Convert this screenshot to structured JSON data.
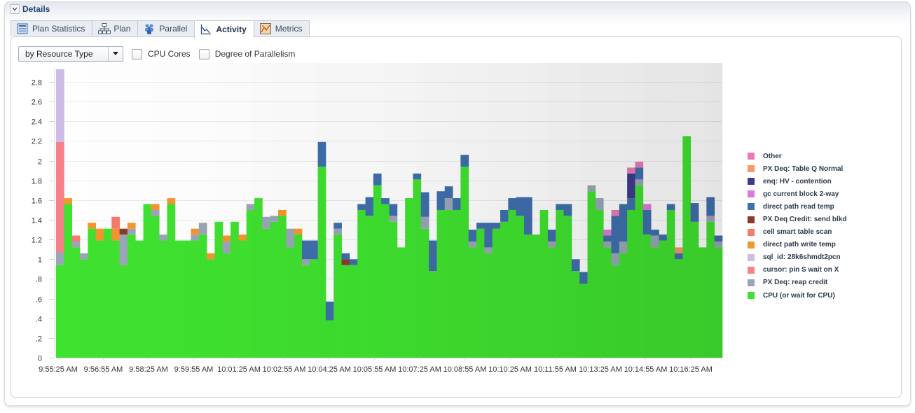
{
  "section": {
    "title": "Details",
    "collapse_icon": "chevron-down-icon"
  },
  "tabs": [
    {
      "label": "Plan Statistics",
      "icon": "table-icon",
      "active": false
    },
    {
      "label": "Plan",
      "icon": "hierarchy-icon",
      "active": false
    },
    {
      "label": "Parallel",
      "icon": "people-icon",
      "active": false
    },
    {
      "label": "Activity",
      "icon": "line-chart-icon",
      "active": true
    },
    {
      "label": "Metrics",
      "icon": "metrics-chart-icon",
      "active": false
    }
  ],
  "toolbar": {
    "group_by": {
      "value": "by Resource Type"
    },
    "checkboxes": [
      {
        "label": "CPU Cores",
        "checked": false
      },
      {
        "label": "Degree of Parallelism",
        "checked": false
      }
    ]
  },
  "chart_data": {
    "type": "bar",
    "stacked": true,
    "title": "",
    "xlabel": "",
    "ylabel": "",
    "ylim": [
      0,
      2.95
    ],
    "yticks": [
      0,
      0.2,
      0.4,
      0.6,
      0.8,
      1,
      1.2,
      1.4,
      1.6,
      1.8,
      2,
      2.2,
      2.4,
      2.6,
      2.8
    ],
    "ytick_labels": [
      "0",
      ".2",
      ".4",
      ".6",
      ".8",
      "1",
      "1.2",
      "1.4",
      "1.6",
      "1.8",
      "2",
      "2.2",
      "2.4",
      "2.6",
      "2.8"
    ],
    "grid": true,
    "legend_position": "right",
    "xtick_labels": [
      "9:55:25 AM",
      "9:56:55 AM",
      "9:58:25 AM",
      "9:59:55 AM",
      "10:01:25 AM",
      "10:02:55 AM",
      "10:04:25 AM",
      "10:05:55 AM",
      "10:07:25 AM",
      "10:08:55 AM",
      "10:10:25 AM",
      "10:11:55 AM",
      "10:13:25 AM",
      "10:14:55 AM",
      "10:16:25 AM"
    ],
    "xtick_every_n_bars": 5.6,
    "categories": [
      {
        "name": "CPU (or wait for CPU)",
        "color": "#3fe22f"
      },
      {
        "name": "PX Deq: reap credit",
        "color": "#9aa6b8"
      },
      {
        "name": "cursor: pin S wait on X",
        "color": "#f7808c"
      },
      {
        "name": "sql_id: 28k6shmdt2pcn",
        "color": "#cdbde6"
      },
      {
        "name": "direct path write temp",
        "color": "#f4962e"
      },
      {
        "name": "cell smart table scan",
        "color": "#f57b6a"
      },
      {
        "name": "PX Deq Credit: send blkd",
        "color": "#8b3a2a"
      },
      {
        "name": "direct path read temp",
        "color": "#3f6fad"
      },
      {
        "name": "gc current block 2-way",
        "color": "#e07ad8"
      },
      {
        "name": "enq: HV - contention",
        "color": "#3d3a8e"
      },
      {
        "name": "PX Deq: Table Q Normal",
        "color": "#f5996a"
      },
      {
        "name": "Other",
        "color": "#ec7ab8"
      }
    ],
    "legend_order": [
      11,
      10,
      9,
      8,
      7,
      6,
      5,
      4,
      3,
      2,
      1,
      0
    ],
    "bars": [
      [
        [
          0,
          0.94
        ],
        [
          1,
          0.13
        ],
        [
          2,
          1.12
        ],
        [
          3,
          0.74
        ]
      ],
      [
        [
          0,
          1.56
        ],
        [
          4,
          0.06
        ]
      ],
      [
        [
          0,
          1.12
        ],
        [
          1,
          0.06
        ],
        [
          5,
          0.06
        ]
      ],
      [
        [
          0,
          1.0
        ],
        [
          1,
          0.06
        ]
      ],
      [
        [
          0,
          1.31
        ],
        [
          4,
          0.06
        ]
      ],
      [
        [
          0,
          1.19
        ],
        [
          4,
          0.12
        ]
      ],
      [
        [
          0,
          1.31
        ]
      ],
      [
        [
          0,
          1.19
        ],
        [
          4,
          0.12
        ],
        [
          5,
          0.12
        ]
      ],
      [
        [
          0,
          0.94
        ],
        [
          1,
          0.31
        ],
        [
          6,
          0.06
        ]
      ],
      [
        [
          0,
          1.25
        ],
        [
          1,
          0.06
        ],
        [
          4,
          0.06
        ]
      ],
      [
        [
          0,
          1.19
        ]
      ],
      [
        [
          0,
          1.56
        ]
      ],
      [
        [
          0,
          1.44
        ],
        [
          1,
          0.06
        ],
        [
          4,
          0.06
        ]
      ],
      [
        [
          0,
          1.19
        ],
        [
          1,
          0.06
        ]
      ],
      [
        [
          0,
          1.56
        ],
        [
          4,
          0.06
        ]
      ],
      [
        [
          0,
          1.19
        ]
      ],
      [
        [
          0,
          1.19
        ]
      ],
      [
        [
          0,
          1.19
        ],
        [
          1,
          0.06
        ],
        [
          4,
          0.06
        ]
      ],
      [
        [
          0,
          1.25
        ],
        [
          1,
          0.12
        ]
      ],
      [
        [
          0,
          1.0
        ],
        [
          4,
          0.06
        ]
      ],
      [
        [
          0,
          1.38
        ]
      ],
      [
        [
          0,
          1.06
        ],
        [
          1,
          0.12
        ],
        [
          4,
          0.06
        ]
      ],
      [
        [
          0,
          1.38
        ]
      ],
      [
        [
          0,
          1.19
        ],
        [
          4,
          0.06
        ]
      ],
      [
        [
          0,
          1.5
        ],
        [
          1,
          0.06
        ]
      ],
      [
        [
          0,
          1.62
        ]
      ],
      [
        [
          0,
          1.31
        ],
        [
          1,
          0.12
        ]
      ],
      [
        [
          0,
          1.38
        ],
        [
          1,
          0.06
        ]
      ],
      [
        [
          0,
          1.44
        ],
        [
          4,
          0.06
        ]
      ],
      [
        [
          0,
          1.12
        ],
        [
          1,
          0.19
        ]
      ],
      [
        [
          0,
          1.25
        ],
        [
          4,
          0.06
        ]
      ],
      [
        [
          0,
          0.94
        ],
        [
          1,
          0.06
        ],
        [
          7,
          0.19
        ]
      ],
      [
        [
          0,
          1.0
        ],
        [
          7,
          0.19
        ]
      ],
      [
        [
          0,
          1.94
        ],
        [
          7,
          0.25
        ]
      ],
      [
        [
          0,
          0.38
        ],
        [
          7,
          0.19
        ]
      ],
      [
        [
          0,
          1.25
        ],
        [
          1,
          0.06
        ],
        [
          7,
          0.06
        ]
      ],
      [
        [
          0,
          0.94
        ],
        [
          6,
          0.06
        ],
        [
          7,
          0.06
        ]
      ],
      [
        [
          0,
          0.94
        ],
        [
          7,
          0.06
        ]
      ],
      [
        [
          0,
          1.5
        ],
        [
          7,
          0.06
        ]
      ],
      [
        [
          0,
          1.44
        ],
        [
          7,
          0.19
        ]
      ],
      [
        [
          0,
          1.75
        ],
        [
          7,
          0.12
        ]
      ],
      [
        [
          0,
          1.56
        ],
        [
          7,
          0.06
        ]
      ],
      [
        [
          0,
          1.38
        ],
        [
          1,
          0.06
        ],
        [
          7,
          0.12
        ]
      ],
      [
        [
          0,
          1.12
        ]
      ],
      [
        [
          0,
          1.62
        ]
      ],
      [
        [
          0,
          1.81
        ],
        [
          7,
          0.06
        ]
      ],
      [
        [
          0,
          1.31
        ],
        [
          1,
          0.12
        ],
        [
          7,
          0.25
        ]
      ],
      [
        [
          0,
          0.88
        ],
        [
          7,
          0.31
        ]
      ],
      [
        [
          0,
          1.5
        ],
        [
          7,
          0.19
        ]
      ],
      [
        [
          0,
          1.5
        ],
        [
          1,
          0.12
        ],
        [
          7,
          0.12
        ]
      ],
      [
        [
          0,
          1.5
        ],
        [
          7,
          0.12
        ]
      ],
      [
        [
          0,
          1.94
        ],
        [
          7,
          0.12
        ]
      ],
      [
        [
          0,
          1.12
        ],
        [
          1,
          0.06
        ],
        [
          7,
          0.12
        ]
      ],
      [
        [
          0,
          1.31
        ],
        [
          7,
          0.06
        ]
      ],
      [
        [
          0,
          1.06
        ],
        [
          1,
          0.06
        ],
        [
          7,
          0.25
        ]
      ],
      [
        [
          0,
          1.31
        ],
        [
          7,
          0.06
        ]
      ],
      [
        [
          0,
          1.38
        ],
        [
          7,
          0.12
        ]
      ],
      [
        [
          0,
          1.5
        ],
        [
          7,
          0.12
        ]
      ],
      [
        [
          0,
          1.44
        ],
        [
          7,
          0.19
        ]
      ],
      [
        [
          0,
          1.25
        ],
        [
          7,
          0.38
        ]
      ],
      [
        [
          0,
          1.25
        ]
      ],
      [
        [
          0,
          1.5
        ]
      ],
      [
        [
          0,
          1.12
        ],
        [
          1,
          0.06
        ],
        [
          7,
          0.12
        ]
      ],
      [
        [
          0,
          1.5
        ],
        [
          7,
          0.06
        ]
      ],
      [
        [
          0,
          1.44
        ],
        [
          7,
          0.12
        ]
      ],
      [
        [
          0,
          0.88
        ],
        [
          7,
          0.12
        ]
      ],
      [
        [
          0,
          0.75
        ],
        [
          7,
          0.12
        ]
      ],
      [
        [
          0,
          1.69
        ],
        [
          1,
          0.06
        ]
      ],
      [
        [
          0,
          1.5
        ],
        [
          1,
          0.12
        ]
      ],
      [
        [
          0,
          1.12
        ],
        [
          1,
          0.06
        ],
        [
          7,
          0.06
        ],
        [
          8,
          0.06
        ]
      ],
      [
        [
          0,
          0.94
        ],
        [
          1,
          0.12
        ],
        [
          7,
          0.38
        ],
        [
          11,
          0.06
        ]
      ],
      [
        [
          0,
          1.06
        ],
        [
          1,
          0.12
        ],
        [
          7,
          0.38
        ]
      ],
      [
        [
          0,
          1.5
        ],
        [
          7,
          0.12
        ],
        [
          9,
          0.25
        ],
        [
          11,
          0.06
        ]
      ],
      [
        [
          0,
          1.75
        ],
        [
          1,
          0.06
        ],
        [
          7,
          0.12
        ],
        [
          11,
          0.06
        ]
      ],
      [
        [
          0,
          1.25
        ],
        [
          7,
          0.25
        ],
        [
          8,
          0.06
        ]
      ],
      [
        [
          0,
          1.12
        ],
        [
          1,
          0.12
        ],
        [
          7,
          0.06
        ]
      ],
      [
        [
          0,
          1.19
        ],
        [
          7,
          0.06
        ]
      ],
      [
        [
          0,
          1.5
        ],
        [
          7,
          0.06
        ]
      ],
      [
        [
          0,
          1.0
        ],
        [
          7,
          0.06
        ],
        [
          10,
          0.06
        ]
      ],
      [
        [
          0,
          2.25
        ]
      ],
      [
        [
          0,
          1.38
        ],
        [
          7,
          0.19
        ]
      ],
      [
        [
          0,
          1.12
        ]
      ],
      [
        [
          0,
          1.38
        ],
        [
          1,
          0.06
        ],
        [
          7,
          0.19
        ]
      ],
      [
        [
          0,
          1.12
        ],
        [
          1,
          0.06
        ],
        [
          7,
          0.06
        ]
      ]
    ]
  }
}
